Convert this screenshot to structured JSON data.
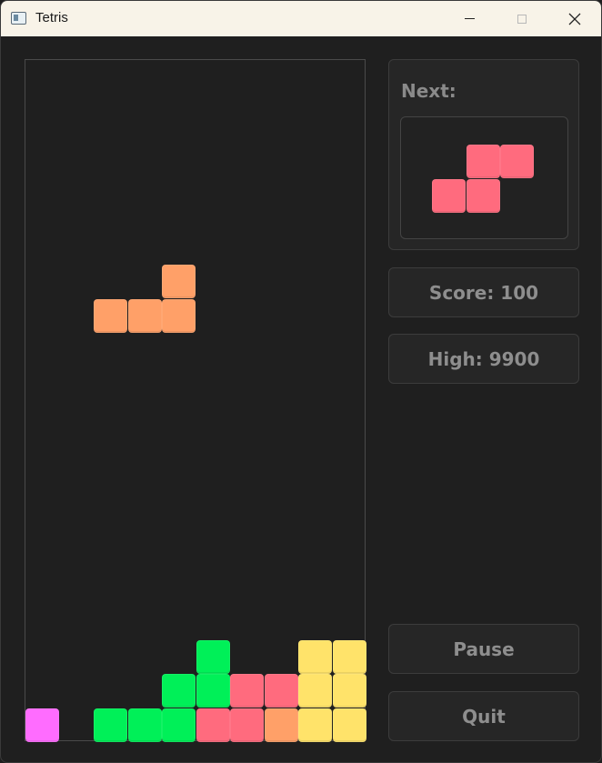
{
  "window": {
    "title": "Tetris"
  },
  "sidebar": {
    "next_label": "Next:",
    "score_label": "Score: 100",
    "high_label": "High: 9900",
    "pause_label": "Pause",
    "quit_label": "Quit"
  },
  "game": {
    "score": 100,
    "high_score": 9900,
    "board_columns": 10,
    "board_rows": 20,
    "colors": {
      "orange": "#ffa068",
      "pink": "#ff6b7e",
      "green": "#00f058",
      "yellow": "#ffe36a",
      "magenta": "#ff6cff"
    },
    "falling_piece": {
      "shape": "L",
      "color": "orange",
      "cells": [
        [
          4,
          6
        ],
        [
          2,
          7
        ],
        [
          3,
          7
        ],
        [
          4,
          7
        ]
      ]
    },
    "locked_cells": [
      {
        "col": 5,
        "row": 17,
        "color": "green"
      },
      {
        "col": 8,
        "row": 17,
        "color": "yellow"
      },
      {
        "col": 9,
        "row": 17,
        "color": "yellow"
      },
      {
        "col": 4,
        "row": 18,
        "color": "green"
      },
      {
        "col": 5,
        "row": 18,
        "color": "green"
      },
      {
        "col": 6,
        "row": 18,
        "color": "pink"
      },
      {
        "col": 7,
        "row": 18,
        "color": "pink"
      },
      {
        "col": 8,
        "row": 18,
        "color": "yellow"
      },
      {
        "col": 9,
        "row": 18,
        "color": "yellow"
      },
      {
        "col": 0,
        "row": 19,
        "color": "magenta"
      },
      {
        "col": 2,
        "row": 19,
        "color": "green"
      },
      {
        "col": 3,
        "row": 19,
        "color": "green"
      },
      {
        "col": 4,
        "row": 19,
        "color": "green"
      },
      {
        "col": 5,
        "row": 19,
        "color": "pink"
      },
      {
        "col": 6,
        "row": 19,
        "color": "pink"
      },
      {
        "col": 7,
        "row": 19,
        "color": "orange"
      },
      {
        "col": 8,
        "row": 19,
        "color": "yellow"
      },
      {
        "col": 9,
        "row": 19,
        "color": "yellow"
      }
    ],
    "next_piece": {
      "shape": "S",
      "color": "pink",
      "cells": [
        [
          1,
          0
        ],
        [
          2,
          0
        ],
        [
          0,
          1
        ],
        [
          1,
          1
        ]
      ]
    }
  }
}
